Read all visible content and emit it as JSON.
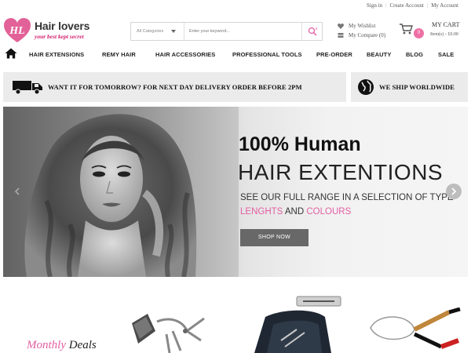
{
  "top_links": {
    "sign_in": "Sign in",
    "create_account": "Create Account",
    "my_account": "My Account",
    "separator": "|"
  },
  "logo": {
    "mark": "HL",
    "name": "Hair lovers",
    "tagline": "your best kept secret"
  },
  "search": {
    "category": "All Categories",
    "placeholder": "Enter your keyword..."
  },
  "wishlist": {
    "label": "My Wishlist",
    "compare": "My Compare (0)"
  },
  "cart": {
    "title": "MY CART",
    "summary": "Item(s) - £0.00",
    "count": "0"
  },
  "nav": [
    "HAIR EXTENSIONS",
    "REMY HAIR",
    "HAIR ACCESSORIES",
    "PROFESSIONAL TOOLS",
    "PRE-ORDER",
    "BEAUTY",
    "BLOG",
    "SALE"
  ],
  "banners": {
    "delivery": "WANT IT FOR TOMORROW? FOR NEXT DAY DELIVERY ORDER BEFORE 2PM",
    "worldwide": "WE SHIP WORLDWIDE"
  },
  "hero": {
    "line1": "100% Human",
    "line2": "HAIR EXTENTIONS",
    "line3": "SEE OUR FULL RANGE IN A SELECTION OF TYPE",
    "highlight1": "LENGHTS",
    "and": " AND ",
    "highlight2": "COLOURS",
    "button": "SHOP NOW"
  },
  "deals": {
    "word1": "Monthly",
    "word2": " Deals"
  },
  "colors": {
    "accent": "#e35ea3",
    "brand": "#d31d6c",
    "button": "#686868",
    "bar": "#ebebeb"
  }
}
